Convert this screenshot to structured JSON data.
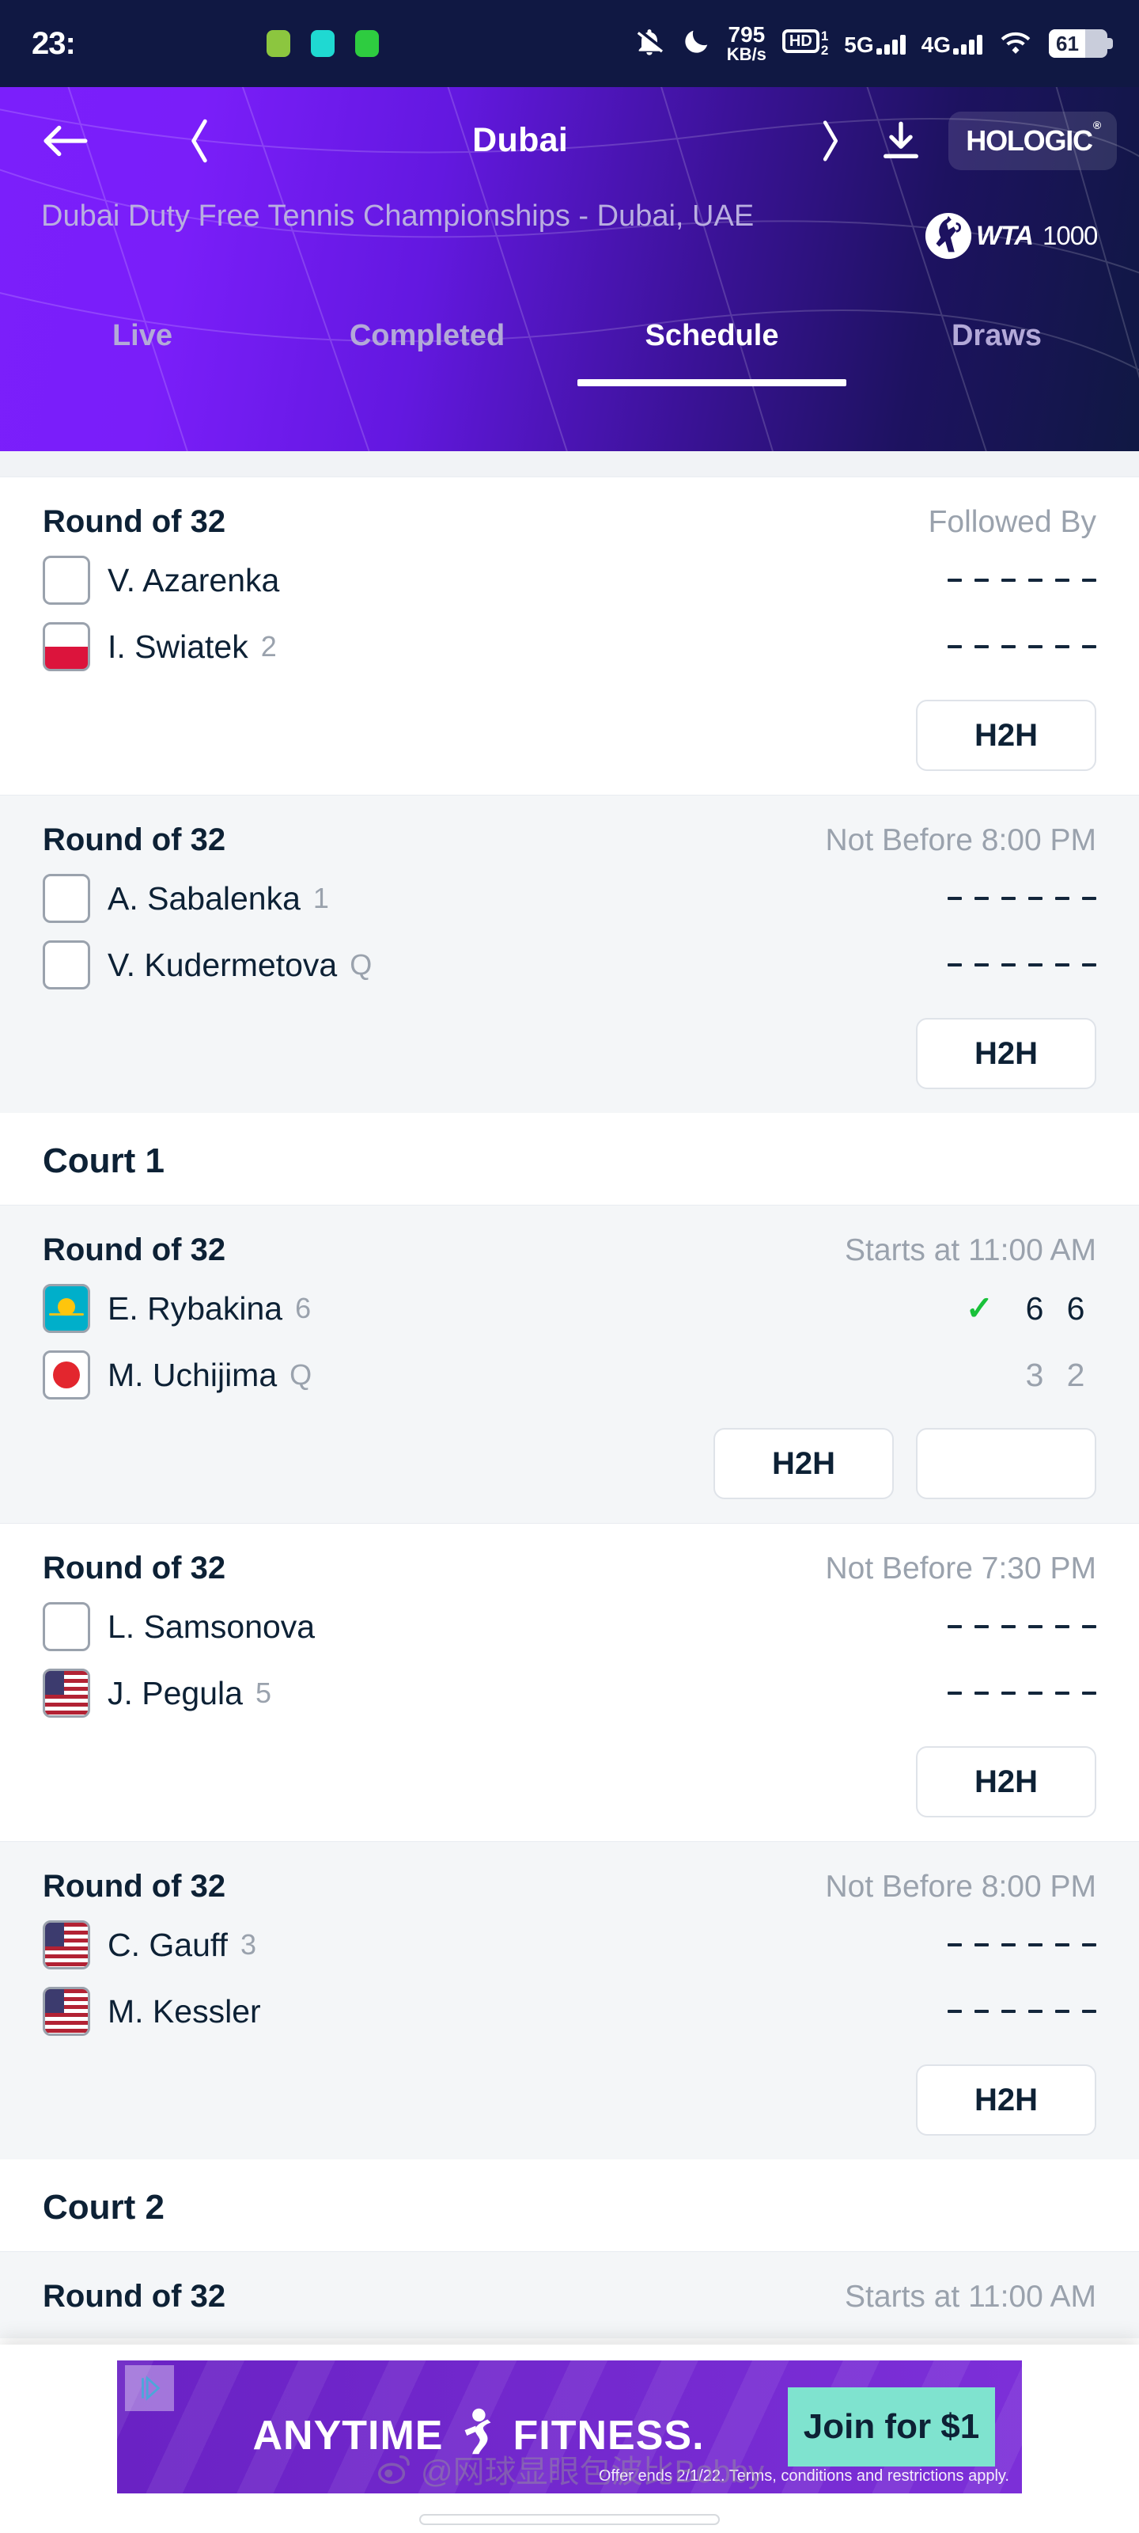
{
  "statusbar": {
    "clock": "23:",
    "network_speed_value": "795",
    "network_speed_unit": "KB/s",
    "hd_label": "HD",
    "hd_sim_1": "1",
    "hd_sim_2": "2",
    "sim1_network": "5G",
    "sim2_network": "4G",
    "battery_level": "61",
    "icons": [
      "mute-icon",
      "do-not-disturb-icon",
      "hd-call-icon",
      "signal-icon",
      "wifi-icon",
      "battery-icon"
    ]
  },
  "header": {
    "title": "Dubai",
    "back_icon": "back-arrow-icon",
    "prev_icon": "chevron-left-icon",
    "next_icon": "chevron-right-icon",
    "download_icon": "download-icon",
    "sponsor": "HOLOGIC",
    "sponsor_mark": "®",
    "tournament": "Dubai Duty Free Tennis Championships - Dubai, UAE",
    "tour_badge": "WTA",
    "tour_level": "1000",
    "gradient_from": "#7b1ffb",
    "gradient_to": "#101843"
  },
  "tabs": [
    {
      "label": "Live",
      "active": false
    },
    {
      "label": "Completed",
      "active": false
    },
    {
      "label": "Schedule",
      "active": true
    },
    {
      "label": "Draws",
      "active": false
    }
  ],
  "buttons": {
    "h2h": "H2H",
    "blank": ""
  },
  "sections": [
    {
      "court": null,
      "matches": [
        {
          "round": "Round of 32",
          "time": "Followed By",
          "players": [
            {
              "name": "V. Azarenka",
              "seed": "",
              "flag": "empty",
              "flag_name": "placeholder-flag-icon",
              "scores": [],
              "winner": false
            },
            {
              "name": "I. Swiatek",
              "seed": "2",
              "flag": "pol",
              "flag_name": "poland-flag-icon",
              "scores": [],
              "winner": false
            }
          ],
          "actions": [
            "H2H"
          ]
        },
        {
          "round": "Round of 32",
          "time": "Not Before 8:00 PM",
          "players": [
            {
              "name": "A. Sabalenka",
              "seed": "1",
              "flag": "empty",
              "flag_name": "placeholder-flag-icon",
              "scores": [],
              "winner": false
            },
            {
              "name": "V. Kudermetova",
              "seed": "Q",
              "flag": "empty",
              "flag_name": "placeholder-flag-icon",
              "scores": [],
              "winner": false
            }
          ],
          "actions": [
            "H2H"
          ]
        }
      ]
    },
    {
      "court": "Court 1",
      "matches": [
        {
          "round": "Round of 32",
          "time": "Starts at 11:00 AM",
          "players": [
            {
              "name": "E. Rybakina",
              "seed": "6",
              "flag": "kaz",
              "flag_name": "kazakhstan-flag-icon",
              "scores": [
                "6",
                "6"
              ],
              "winner": true
            },
            {
              "name": "M. Uchijima",
              "seed": "Q",
              "flag": "jpn",
              "flag_name": "japan-flag-icon",
              "scores": [
                "3",
                "2"
              ],
              "winner": false
            }
          ],
          "actions": [
            "H2H",
            ""
          ]
        },
        {
          "round": "Round of 32",
          "time": "Not Before 7:30 PM",
          "players": [
            {
              "name": "L. Samsonova",
              "seed": "",
              "flag": "empty",
              "flag_name": "placeholder-flag-icon",
              "scores": [],
              "winner": false
            },
            {
              "name": "J. Pegula",
              "seed": "5",
              "flag": "usa",
              "flag_name": "usa-flag-icon",
              "scores": [],
              "winner": false
            }
          ],
          "actions": [
            "H2H"
          ]
        },
        {
          "round": "Round of 32",
          "time": "Not Before 8:00 PM",
          "players": [
            {
              "name": "C. Gauff",
              "seed": "3",
              "flag": "usa",
              "flag_name": "usa-flag-icon",
              "scores": [],
              "winner": false
            },
            {
              "name": "M. Kessler",
              "seed": "",
              "flag": "usa",
              "flag_name": "usa-flag-icon",
              "scores": [],
              "winner": false
            }
          ],
          "actions": [
            "H2H"
          ]
        }
      ]
    },
    {
      "court": "Court 2",
      "matches": [
        {
          "round": "Round of 32",
          "time": "Starts at 11:00 AM",
          "players": [],
          "actions": []
        }
      ]
    }
  ],
  "ad": {
    "brand_left": "ANYTIME",
    "brand_right": "FITNESS.",
    "cta": "Join for $1",
    "fine_print": "Offer ends 2/1/22. Terms, conditions and restrictions apply.",
    "adchoices_icon": "adchoices-icon"
  },
  "watermark": {
    "text": "@网球显眼包波比Bobby",
    "icon": "weibo-icon"
  }
}
